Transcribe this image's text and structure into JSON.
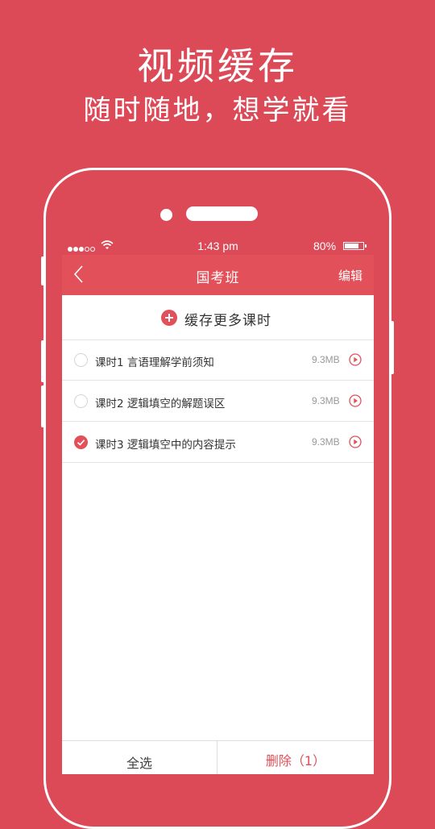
{
  "promo": {
    "title": "视频缓存",
    "subtitle": "随时随地，想学就看"
  },
  "status_bar": {
    "time": "1:43 pm",
    "battery": "80%",
    "battery_level": 0.8
  },
  "nav": {
    "title": "国考班",
    "edit_label": "编辑"
  },
  "cache_more_label": "缓存更多课时",
  "lessons": [
    {
      "label": "课时1  言语理解学前须知",
      "size": "9.3MB",
      "selected": false
    },
    {
      "label": "课时2  逻辑填空的解题误区",
      "size": "9.3MB",
      "selected": false
    },
    {
      "label": "课时3  逻辑填空中的内容提示",
      "size": "9.3MB",
      "selected": true
    }
  ],
  "bottom": {
    "select_all": "全选",
    "delete": "删除（1）"
  },
  "colors": {
    "background": "#dc4a57",
    "accent": "#e25059"
  }
}
